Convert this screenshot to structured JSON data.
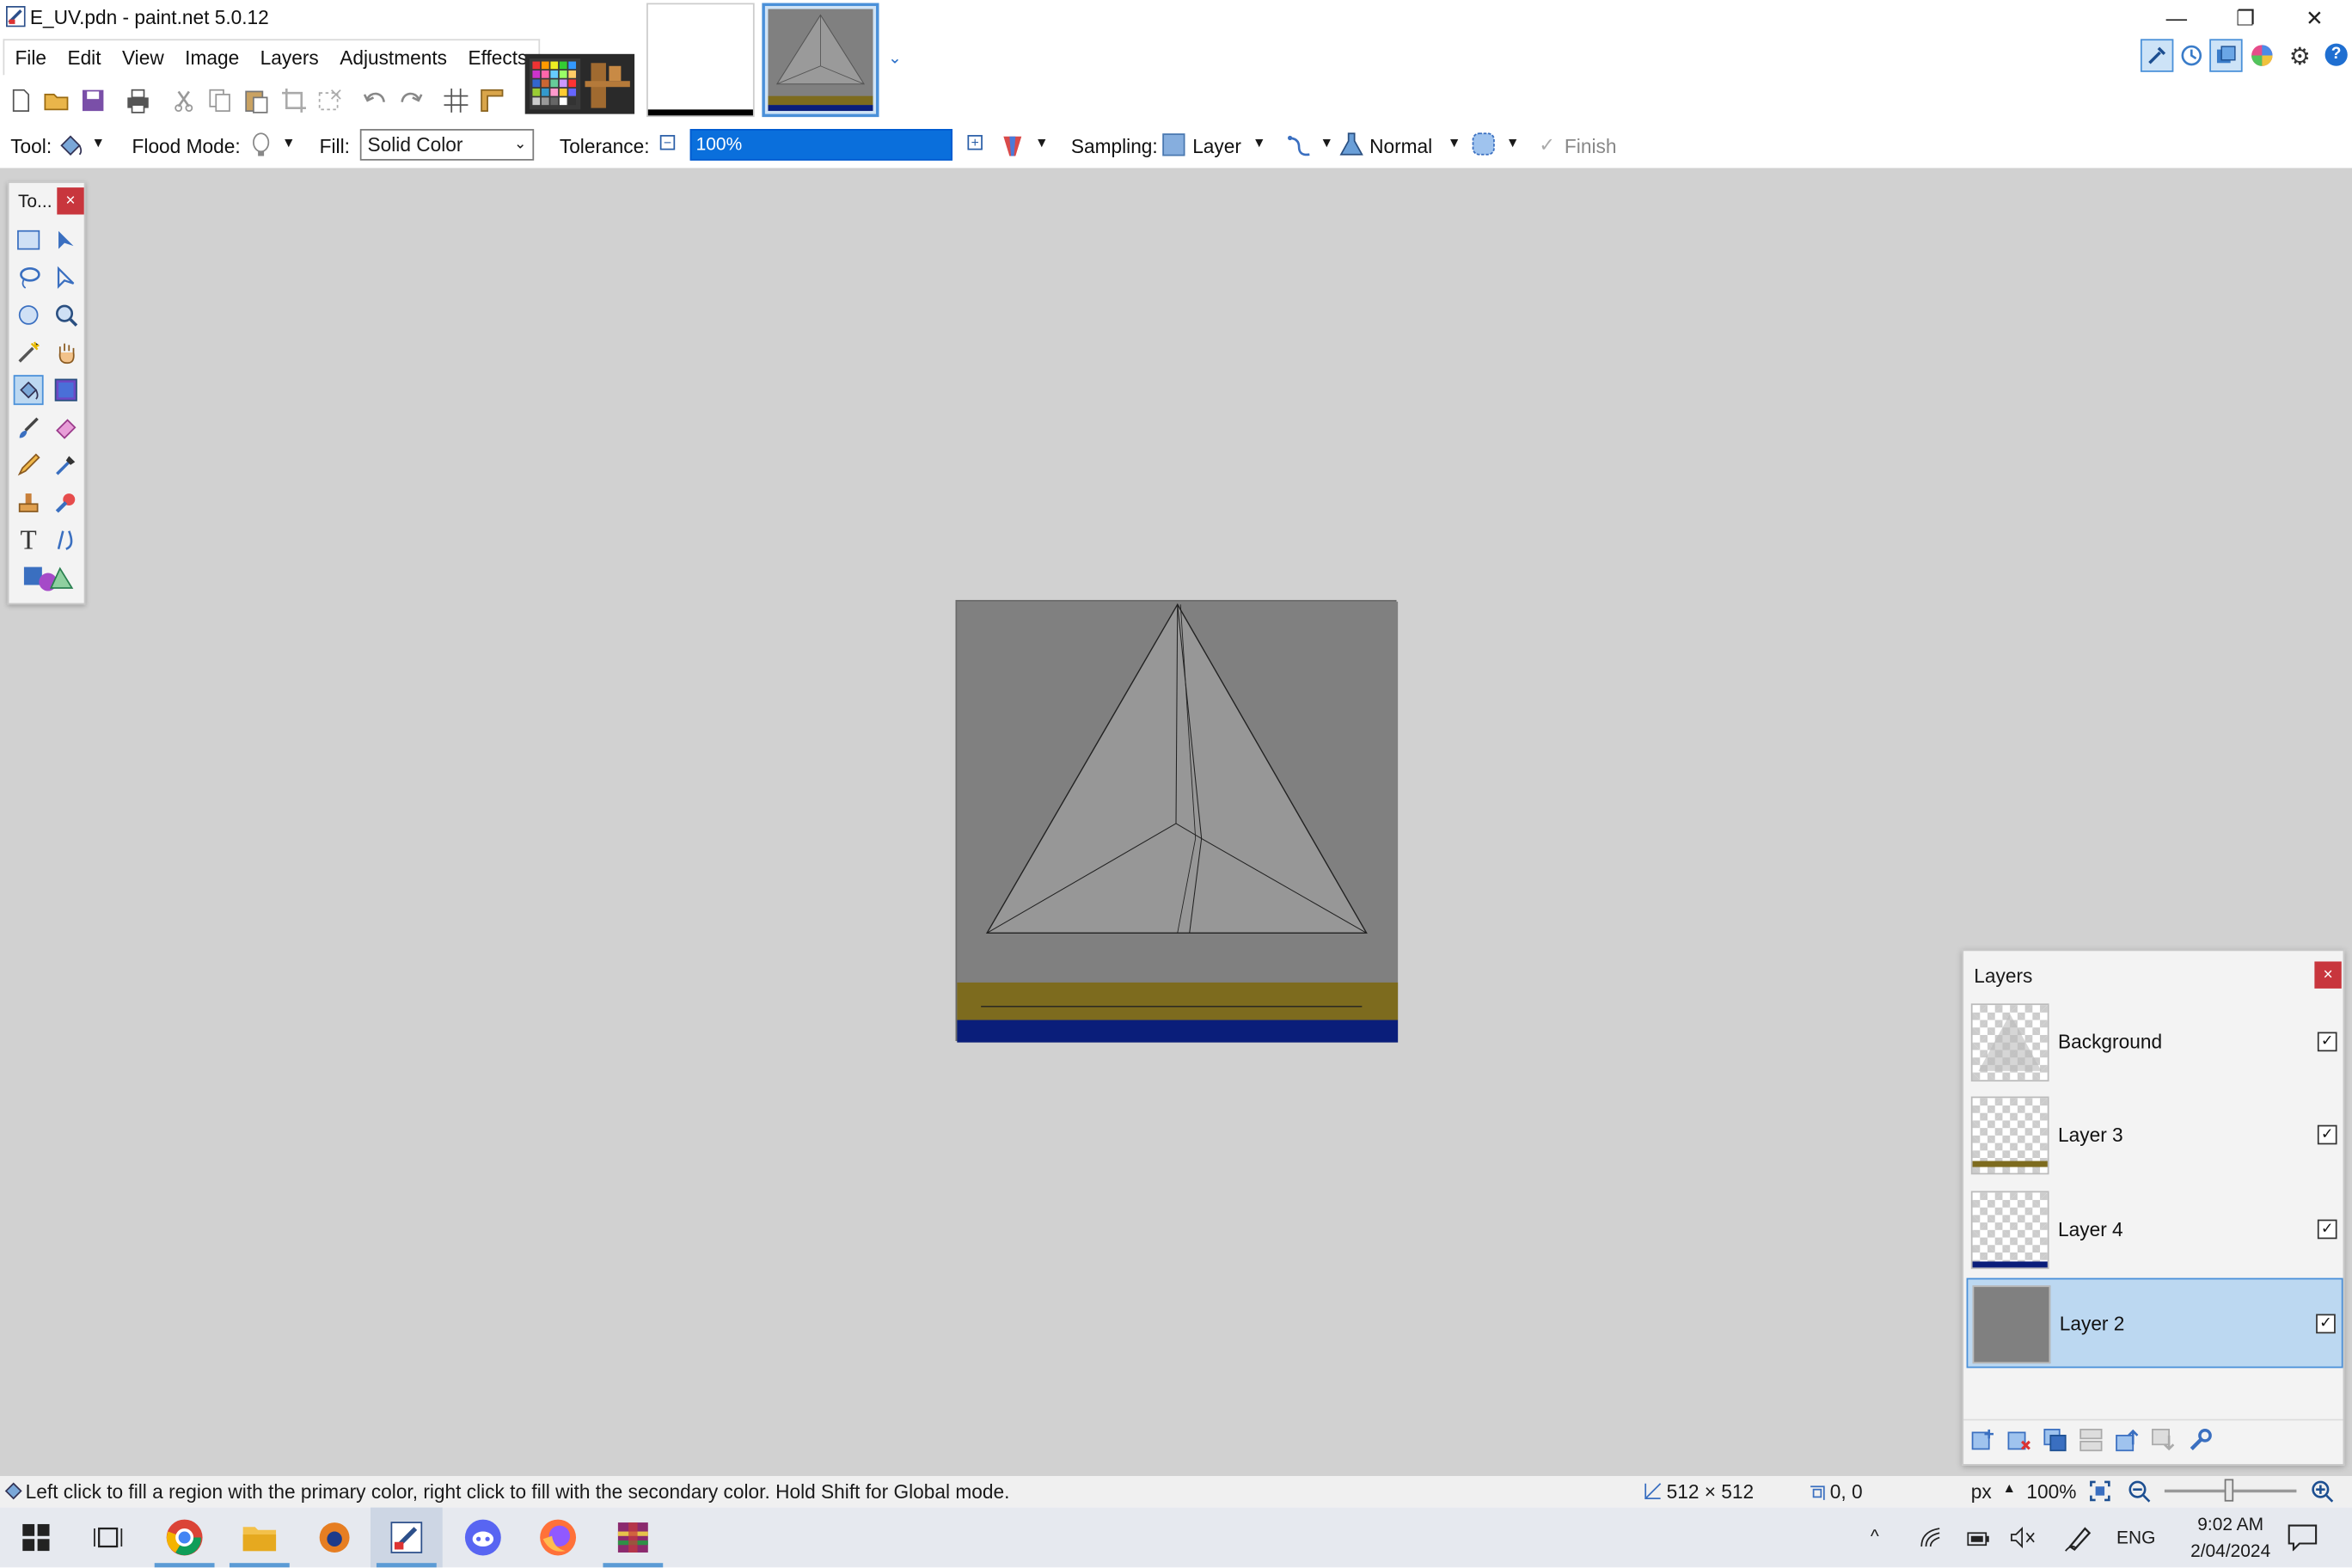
{
  "window": {
    "title": "E_UV.pdn - paint.net 5.0.12",
    "minimize": "—",
    "restore": "❐",
    "close": "✕"
  },
  "menu": [
    "File",
    "Edit",
    "View",
    "Image",
    "Layers",
    "Adjustments",
    "Effects"
  ],
  "options_bar": {
    "tool_label": "Tool:",
    "flood_mode_label": "Flood Mode:",
    "fill_label": "Fill:",
    "fill_value": "Solid Color",
    "tolerance_label": "Tolerance:",
    "tolerance_value": "100%",
    "sampling_label": "Sampling:",
    "sampling_value": "Layer",
    "blend_mode": "Normal",
    "finish_label": "Finish"
  },
  "tools_window": {
    "title": "To...",
    "close": "×"
  },
  "layers_window": {
    "title": "Layers",
    "close": "×",
    "layers": [
      {
        "name": "Background",
        "checked": "✓",
        "selected": false
      },
      {
        "name": "Layer 3",
        "checked": "✓",
        "selected": false
      },
      {
        "name": "Layer 4",
        "checked": "✓",
        "selected": false
      },
      {
        "name": "Layer 2",
        "checked": "✓",
        "selected": true
      }
    ]
  },
  "status_bar": {
    "hint": "Left click to fill a region with the primary color, right click to fill with the secondary color. Hold Shift for Global mode.",
    "image_size": "512 × 512",
    "cursor_pos": "0, 0",
    "units": "px",
    "zoom": "100%"
  },
  "taskbar": {
    "language": "ENG",
    "time": "9:02 AM",
    "date": "2/04/2024"
  },
  "colors": {
    "canvas_gray": "#808080",
    "gold_band": "#7d6b1e",
    "blue_band": "#0a1e7a",
    "accent": "#0a6fdc",
    "close_red": "#c8363d"
  }
}
